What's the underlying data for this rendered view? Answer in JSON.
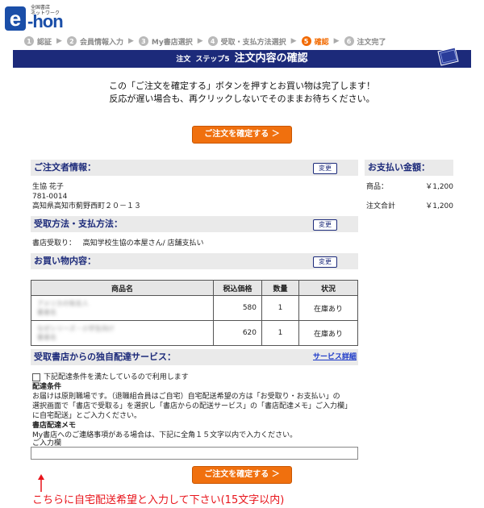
{
  "logo": {
    "letter": "e",
    "name": "-hon",
    "small1": "全国書店",
    "small2": "ネットワーク"
  },
  "steps": [
    {
      "num": "1",
      "label": "認証"
    },
    {
      "num": "2",
      "label": "会員情報入力"
    },
    {
      "num": "3",
      "label": "My書店選択"
    },
    {
      "num": "4",
      "label": "受取・支払方法選択"
    },
    {
      "num": "5",
      "label": "確認"
    },
    {
      "num": "6",
      "label": "注文完了"
    }
  ],
  "step_separator": "▶",
  "title": {
    "prefix": "注文",
    "step": "ステップ5",
    "main": "注文内容の確認"
  },
  "notice": {
    "line1": "この「ご注文を確定する」ボタンを押すとお買い物は完了します！",
    "line2": "反応が遅い場合も、再クリックしないでそのままお待ちください。"
  },
  "confirm_button": "ご注文を確定する ＞",
  "change_label": "変更",
  "orderer": {
    "heading": "ご注文者情報：",
    "name": "生協 花子",
    "zip": "781-0014",
    "address": "高知県高知市薊野西町２０－１３"
  },
  "method": {
    "heading": "受取方法・支払方法：",
    "label": "書店受取り：",
    "value": "高知学校生協の本屋さん/ 店舗支払い"
  },
  "purchase": {
    "heading": "お買い物内容：",
    "columns": [
      "商品名",
      "税込価格",
      "数量",
      "状況"
    ],
    "rows": [
      {
        "title": "アメリカの有名人",
        "author": "著者名",
        "price": "580",
        "qty": "1",
        "status": "在庫あり"
      },
      {
        "title": "なぜシリーズ・小学生向け",
        "author": "著者名",
        "price": "620",
        "qty": "1",
        "status": "在庫あり"
      }
    ]
  },
  "payment": {
    "heading": "お支払い金額：",
    "goods_label": "商品：",
    "goods_value": "￥1,200",
    "total_label": "注文合計",
    "total_value": "￥1,200"
  },
  "delivery": {
    "heading": "受取書店からの独自配達サービス：",
    "detail_link": "サービス詳細",
    "checkbox_label": "下記配達条件を満たしているので利用します",
    "conditions_heading": "配達条件",
    "conditions_line1": "お届けは原則職場です。（退職組合員はご自宅）自宅配送希望の方は「お受取り・お支払い」の",
    "conditions_line2": "選択画面で「書店で受取る」を選択し「書店からの配送サービス」の「書店配達メモ」ご入力欄」",
    "conditions_line3": "に自宅配送」とご入力ください。",
    "memo_heading": "書店配達メモ",
    "memo_desc": "My書店へのご連絡事項がある場合は、下記に全角１５文字以内で入力ください。",
    "memo_label": "ご入力欄",
    "memo_value": ""
  },
  "annotation": "こちらに自宅配送希望と入力して下さい(15文字以内)",
  "colors": {
    "navy": "#1c2a7a",
    "orange": "#f0700e",
    "red": "#e8141b"
  }
}
